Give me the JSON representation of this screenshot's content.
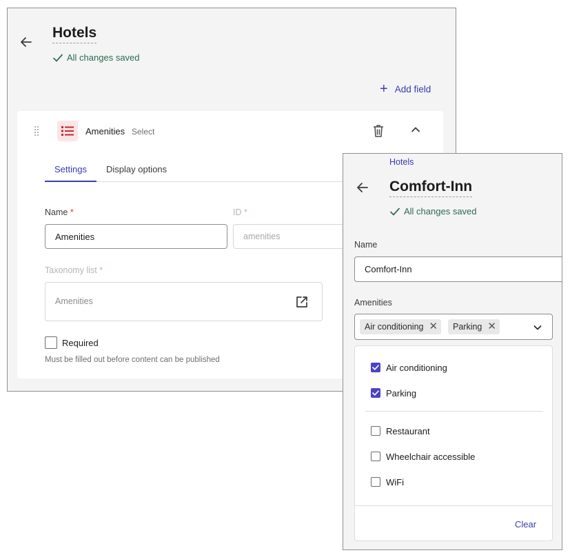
{
  "editor": {
    "title": "Hotels",
    "status": "All changes saved",
    "add_field_label": "Add field",
    "field": {
      "name": "Amenities",
      "type": "Select",
      "tabs": [
        "Settings",
        "Display options"
      ],
      "active_tab": "Settings",
      "name_label": "Name",
      "name_value": "Amenities",
      "id_label": "ID",
      "id_value": "amenities",
      "required_mark": "*",
      "taxonomy_label": "Taxonomy list",
      "taxonomy_value": "Amenities",
      "required_label": "Required",
      "required_help": "Must be filled out before content can be published"
    }
  },
  "entry": {
    "breadcrumb": "Hotels",
    "title": "Comfort-Inn",
    "status": "All changes saved",
    "name_label": "Name",
    "name_value": "Comfort-Inn",
    "amenities_label": "Amenities",
    "selected_chips": [
      "Air conditioning",
      "Parking"
    ],
    "options": [
      {
        "label": "Air conditioning",
        "checked": true
      },
      {
        "label": "Parking",
        "checked": true
      },
      {
        "label": "Restaurant",
        "checked": false
      },
      {
        "label": "Wheelchair accessible",
        "checked": false
      },
      {
        "label": "WiFi",
        "checked": false
      }
    ],
    "clear_label": "Clear"
  },
  "colors": {
    "accent": "#3a3ab0",
    "checkbox_on": "#4b43c7",
    "saved": "#2c6a4f",
    "field_icon": "#c0282d",
    "field_icon_bg": "#fde5e5"
  }
}
